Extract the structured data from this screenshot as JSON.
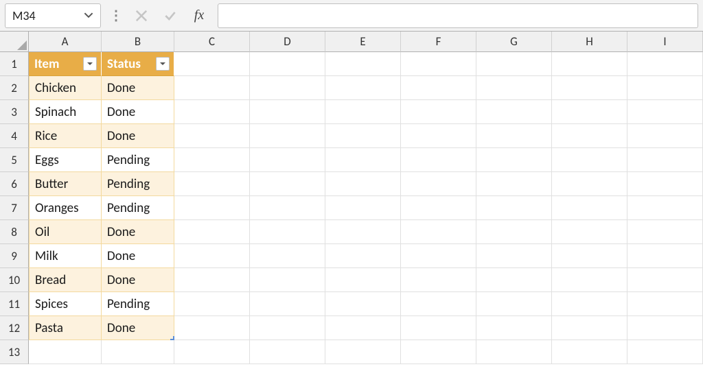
{
  "nameBox": {
    "value": "M34"
  },
  "formula": {
    "value": "",
    "fxLabel": "fx"
  },
  "columns": [
    "A",
    "B",
    "C",
    "D",
    "E",
    "F",
    "G",
    "H",
    "I"
  ],
  "columnWidths": {
    "A": 106,
    "B": 106,
    "other": 110
  },
  "rowCount": 13,
  "table": {
    "headers": [
      "Item",
      "Status"
    ],
    "rows": [
      {
        "item": "Chicken",
        "status": "Done"
      },
      {
        "item": "Spinach",
        "status": "Done"
      },
      {
        "item": "Rice",
        "status": "Done"
      },
      {
        "item": "Eggs",
        "status": "Pending"
      },
      {
        "item": "Butter",
        "status": "Pending"
      },
      {
        "item": "Oranges",
        "status": "Pending"
      },
      {
        "item": "Oil",
        "status": "Done"
      },
      {
        "item": "Milk",
        "status": "Done"
      },
      {
        "item": "Bread",
        "status": "Done"
      },
      {
        "item": "Spices",
        "status": "Pending"
      },
      {
        "item": "Pasta",
        "status": "Done"
      }
    ],
    "colors": {
      "headerBg": "#e8ad47",
      "headerText": "#ffffff",
      "bandOdd": "#fdf2de",
      "bandEven": "#ffffff",
      "border": "#f3d99e"
    }
  }
}
